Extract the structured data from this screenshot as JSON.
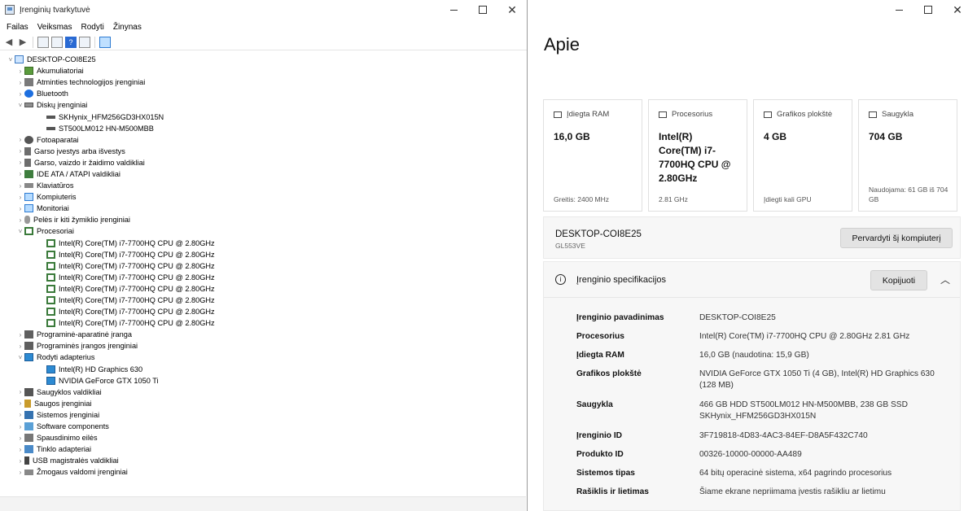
{
  "device_manager": {
    "title": "Įrenginių tvarkytuvė",
    "menu": [
      "Failas",
      "Veiksmas",
      "Rodyti",
      "Žinynas"
    ],
    "tree": [
      {
        "label": "DESKTOP-COI8E25",
        "level": 0,
        "arrow": "˅",
        "icon": "computer"
      },
      {
        "label": "Akumuliatoriai",
        "level": 1,
        "arrow": "›",
        "icon": "battery"
      },
      {
        "label": "Atminties technologijos įrenginiai",
        "level": 1,
        "arrow": "›",
        "icon": "memory"
      },
      {
        "label": "Bluetooth",
        "level": 1,
        "arrow": "›",
        "icon": "bluetooth"
      },
      {
        "label": "Diskų įrenginiai",
        "level": 1,
        "arrow": "˅",
        "icon": "disk"
      },
      {
        "label": "SKHynix_HFM256GD3HX015N",
        "level": 2,
        "arrow": "",
        "icon": "drive"
      },
      {
        "label": "ST500LM012 HN-M500MBB",
        "level": 2,
        "arrow": "",
        "icon": "drive"
      },
      {
        "label": "Fotoaparatai",
        "level": 1,
        "arrow": "›",
        "icon": "camera"
      },
      {
        "label": "Garso įvestys arba išvestys",
        "level": 1,
        "arrow": "›",
        "icon": "speaker"
      },
      {
        "label": "Garso, vaizdo ir žaidimo valdikliai",
        "level": 1,
        "arrow": "›",
        "icon": "speaker"
      },
      {
        "label": "IDE ATA / ATAPI valdikliai",
        "level": 1,
        "arrow": "›",
        "icon": "ide"
      },
      {
        "label": "Klaviatūros",
        "level": 1,
        "arrow": "›",
        "icon": "keyboard"
      },
      {
        "label": "Kompiuteris",
        "level": 1,
        "arrow": "›",
        "icon": "monitor"
      },
      {
        "label": "Monitoriai",
        "level": 1,
        "arrow": "›",
        "icon": "monitor"
      },
      {
        "label": "Pelės ir kiti žymiklio įrenginiai",
        "level": 1,
        "arrow": "›",
        "icon": "mouse"
      },
      {
        "label": "Procesoriai",
        "level": 1,
        "arrow": "˅",
        "icon": "cpu"
      },
      {
        "label": "Intel(R) Core(TM) i7-7700HQ CPU @ 2.80GHz",
        "level": 2,
        "arrow": "",
        "icon": "cpu"
      },
      {
        "label": "Intel(R) Core(TM) i7-7700HQ CPU @ 2.80GHz",
        "level": 2,
        "arrow": "",
        "icon": "cpu"
      },
      {
        "label": "Intel(R) Core(TM) i7-7700HQ CPU @ 2.80GHz",
        "level": 2,
        "arrow": "",
        "icon": "cpu"
      },
      {
        "label": "Intel(R) Core(TM) i7-7700HQ CPU @ 2.80GHz",
        "level": 2,
        "arrow": "",
        "icon": "cpu"
      },
      {
        "label": "Intel(R) Core(TM) i7-7700HQ CPU @ 2.80GHz",
        "level": 2,
        "arrow": "",
        "icon": "cpu"
      },
      {
        "label": "Intel(R) Core(TM) i7-7700HQ CPU @ 2.80GHz",
        "level": 2,
        "arrow": "",
        "icon": "cpu"
      },
      {
        "label": "Intel(R) Core(TM) i7-7700HQ CPU @ 2.80GHz",
        "level": 2,
        "arrow": "",
        "icon": "cpu"
      },
      {
        "label": "Intel(R) Core(TM) i7-7700HQ CPU @ 2.80GHz",
        "level": 2,
        "arrow": "",
        "icon": "cpu"
      },
      {
        "label": "Programinė-aparatinė įranga",
        "level": 1,
        "arrow": "›",
        "icon": "chip"
      },
      {
        "label": "Programinės įrangos įrenginiai",
        "level": 1,
        "arrow": "›",
        "icon": "chip"
      },
      {
        "label": "Rodyti adapterius",
        "level": 1,
        "arrow": "˅",
        "icon": "display"
      },
      {
        "label": "Intel(R) HD Graphics 630",
        "level": 2,
        "arrow": "",
        "icon": "display"
      },
      {
        "label": "NVIDIA GeForce GTX 1050 Ti",
        "level": 2,
        "arrow": "",
        "icon": "display"
      },
      {
        "label": "Saugyklos valdikliai",
        "level": 1,
        "arrow": "›",
        "icon": "storage"
      },
      {
        "label": "Saugos įrenginiai",
        "level": 1,
        "arrow": "›",
        "icon": "key"
      },
      {
        "label": "Sistemos įrenginiai",
        "level": 1,
        "arrow": "›",
        "icon": "system"
      },
      {
        "label": "Software components",
        "level": 1,
        "arrow": "›",
        "icon": "puzzle"
      },
      {
        "label": "Spausdinimo eilės",
        "level": 1,
        "arrow": "›",
        "icon": "printer"
      },
      {
        "label": "Tinklo adapteriai",
        "level": 1,
        "arrow": "›",
        "icon": "network"
      },
      {
        "label": "USB magistralės valdikliai",
        "level": 1,
        "arrow": "›",
        "icon": "usb"
      },
      {
        "label": "Žmogaus valdomi įrenginiai",
        "level": 1,
        "arrow": "›",
        "icon": "hid"
      }
    ]
  },
  "about": {
    "title": "Apie",
    "cards": [
      {
        "name": "ram",
        "label": "Įdiegta RAM",
        "value": "16,0 GB",
        "footer": "Greitis: 2400 MHz"
      },
      {
        "name": "processor",
        "label": "Procesorius",
        "value": "Intel(R) Core(TM) i7-7700HQ CPU @ 2.80GHz",
        "footer": "2.81 GHz"
      },
      {
        "name": "graphics",
        "label": "Grafikos plokštė",
        "value": "4 GB",
        "footer": "Įdiegti kali GPU"
      },
      {
        "name": "storage",
        "label": "Saugykla",
        "value": "704 GB",
        "footer": "Naudojama: 61 GB iš 704 GB"
      }
    ],
    "device": {
      "name": "DESKTOP-COI8E25",
      "model": "GL553VE",
      "rename_button": "Pervardyti šį kompiuterį"
    },
    "specs": {
      "title": "Įrenginio specifikacijos",
      "copy_button": "Kopijuoti",
      "rows": [
        {
          "key": "Įrenginio pavadinimas",
          "value": "DESKTOP-COI8E25"
        },
        {
          "key": "Procesorius",
          "value": "Intel(R) Core(TM) i7-7700HQ CPU @ 2.80GHz   2.81 GHz"
        },
        {
          "key": "Įdiegta RAM",
          "value": "16,0 GB (naudotina: 15,9 GB)"
        },
        {
          "key": "Grafikos plokštė",
          "value": "NVIDIA GeForce GTX 1050 Ti (4 GB), Intel(R) HD Graphics 630 (128 MB)"
        },
        {
          "key": "Saugykla",
          "value": "466 GB HDD ST500LM012 HN-M500MBB, 238 GB SSD SKHynix_HFM256GD3HX015N"
        },
        {
          "key": "Įrenginio ID",
          "value": "3F719818-4D83-4AC3-84EF-D8A5F432C740"
        },
        {
          "key": "Produkto ID",
          "value": "00326-10000-00000-AA489"
        },
        {
          "key": "Sistemos tipas",
          "value": "64 bitų operacinė sistema, x64 pagrindo procesorius"
        },
        {
          "key": "Rašiklis ir lietimas",
          "value": "Šiame ekrane nepriimama įvestis rašikliu ar lietimu"
        }
      ]
    }
  }
}
